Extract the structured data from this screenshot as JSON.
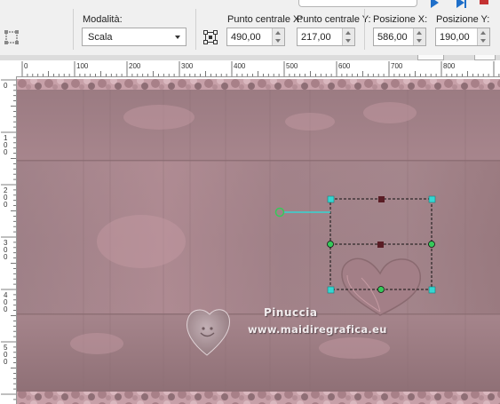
{
  "toolbar": {
    "mode_label": "Modalità:",
    "mode_value": "Scala",
    "center_x_label": "Punto centrale X:",
    "center_x_value": "490,00",
    "center_y_label": "Punto centrale Y:",
    "center_y_value": "217,00",
    "pos_x_label": "Posizione X:",
    "pos_x_value": "586,00",
    "pos_y_label": "Posizione Y:",
    "pos_y_value": "190,00"
  },
  "rulers": {
    "horizontal_labels": [
      "0",
      "100",
      "200",
      "300",
      "400",
      "500",
      "600",
      "700",
      "800"
    ],
    "vertical_labels": [
      "0",
      "100",
      "200",
      "300",
      "400",
      "500"
    ]
  },
  "watermark": {
    "name": "Pinuccia",
    "url": "www.maidiregrafica.eu"
  },
  "colors": {
    "canvas_base": "#a8848b",
    "border_pattern": "#c9a1a9",
    "selection_handle": "#35d6d2",
    "heart_center": "#5a1d25",
    "toolbar_bg": "#f0f0f0"
  },
  "icons": {
    "deform_tool": "deform-tool-icon",
    "center_point": "center-point-icon"
  }
}
